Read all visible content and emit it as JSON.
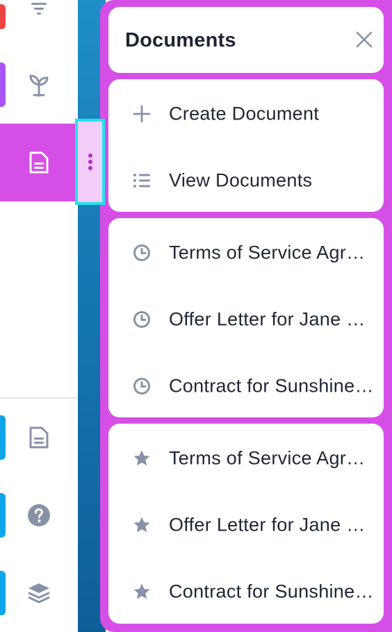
{
  "panel": {
    "title": "Documents",
    "close_icon": "close-icon"
  },
  "actions": [
    {
      "label": "Create Document",
      "icon": "plus-icon"
    },
    {
      "label": "View Documents",
      "icon": "list-icon"
    }
  ],
  "recent": [
    {
      "label": "Terms of Service Agreement",
      "icon": "clock-icon"
    },
    {
      "label": "Offer Letter for Jane Doe",
      "icon": "clock-icon"
    },
    {
      "label": "Contract for Sunshine Inc",
      "icon": "clock-icon"
    }
  ],
  "starred": [
    {
      "label": "Terms of Service Agreement",
      "icon": "star-icon"
    },
    {
      "label": "Offer Letter for Jane Doe",
      "icon": "star-icon"
    },
    {
      "label": "Contract for Sunshine Inc",
      "icon": "star-icon"
    }
  ],
  "rail": {
    "items": [
      {
        "icon": "filter-icon",
        "accent": "#ef4444"
      },
      {
        "icon": "sprout-icon",
        "accent": "#a855f7"
      },
      {
        "icon": "document-icon",
        "active": true
      },
      {
        "icon": "document-icon",
        "accent": "#0ea5e9"
      },
      {
        "icon": "help-icon",
        "accent": "#0ea5e9"
      },
      {
        "icon": "layers-icon",
        "accent": "#0ea5e9"
      }
    ]
  },
  "colors": {
    "panel": "#d54ee6",
    "active_rail": "#d54ee6",
    "handle_border": "#22e3ee",
    "handle_fill": "#f1cdf7",
    "icon_gray": "#8792a6",
    "text": "#1f2634"
  }
}
